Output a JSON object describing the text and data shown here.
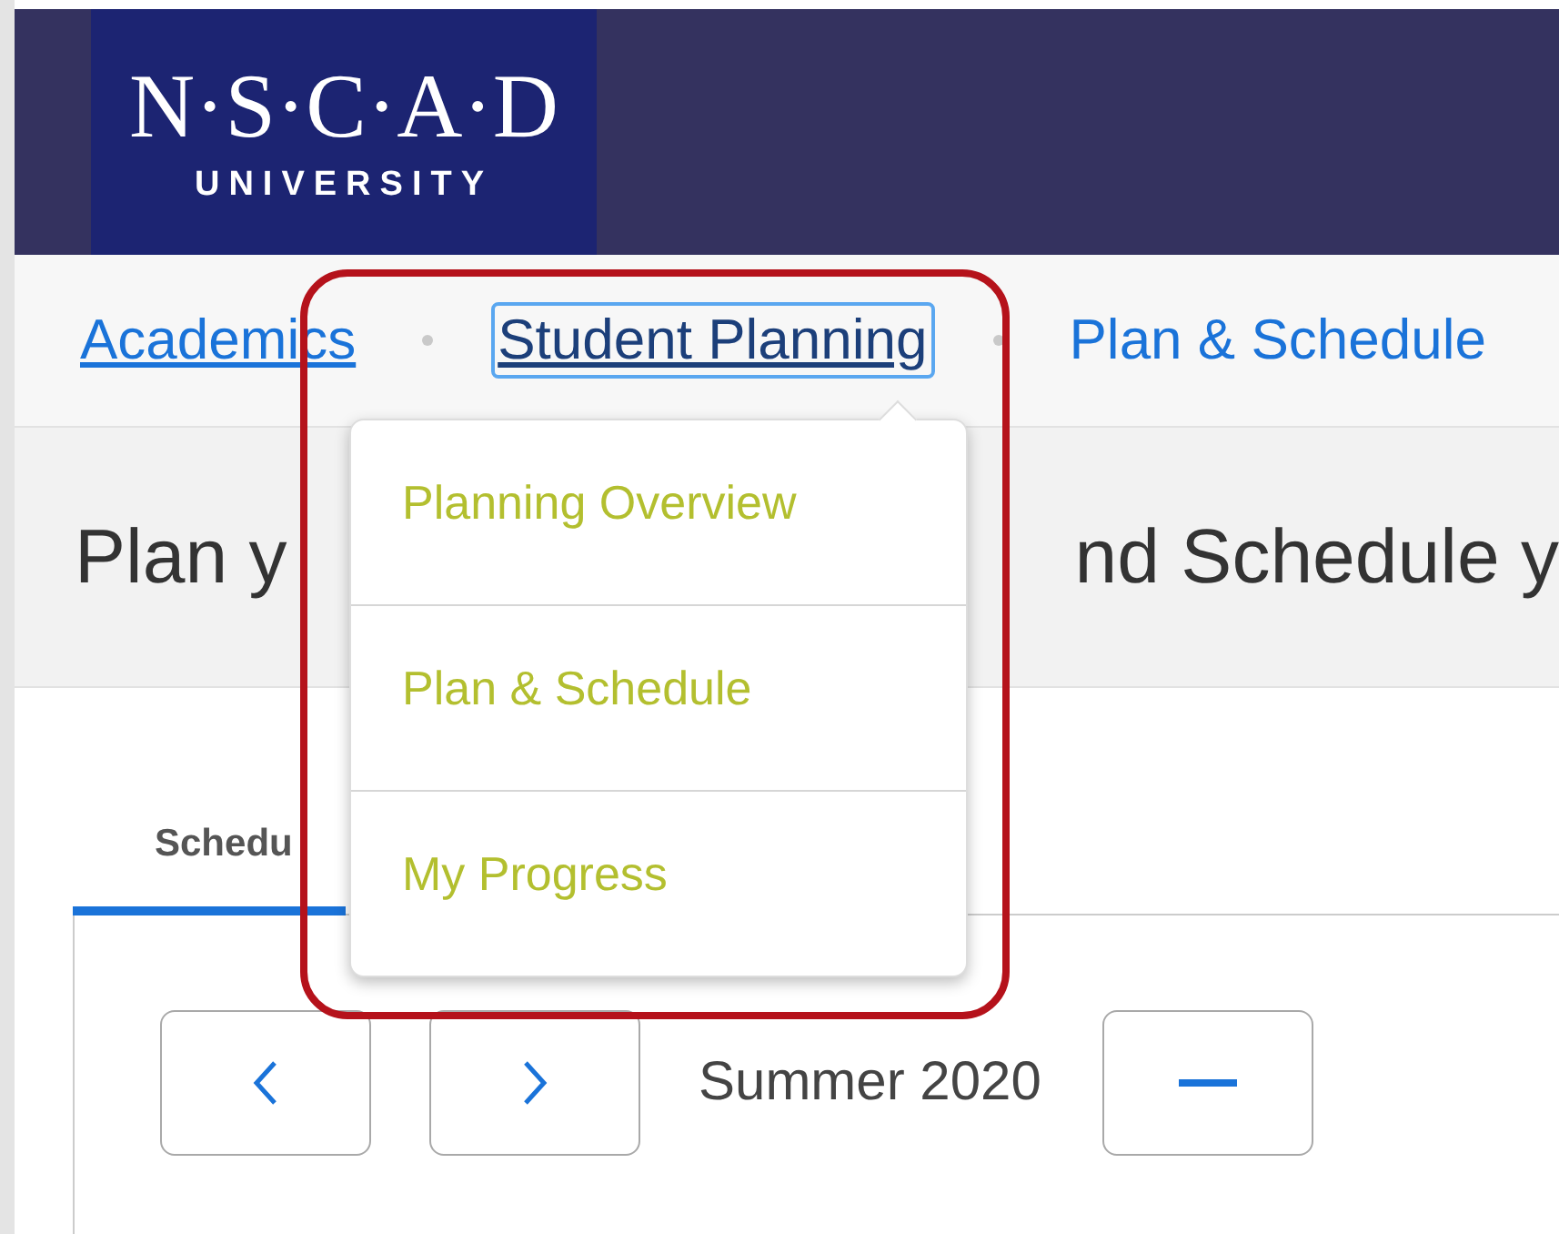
{
  "header": {
    "logo_title": "N·S·C·A·D",
    "logo_subtitle": "UNIVERSITY"
  },
  "breadcrumbs": [
    {
      "label": "Academics",
      "kind": "link",
      "selected": false
    },
    {
      "label": "Student Planning",
      "kind": "link",
      "selected": true
    },
    {
      "label": "Plan & Schedule",
      "kind": "current",
      "selected": false
    }
  ],
  "dropdown": {
    "items": [
      {
        "label": "Planning Overview"
      },
      {
        "label": "Plan & Schedule"
      },
      {
        "label": "My Progress"
      }
    ]
  },
  "heading_parts": [
    "Plan y",
    "nd Schedule y"
  ],
  "tabs": [
    {
      "label": "Schedu",
      "selected": true
    }
  ],
  "term": {
    "label": "Summer 2020"
  }
}
